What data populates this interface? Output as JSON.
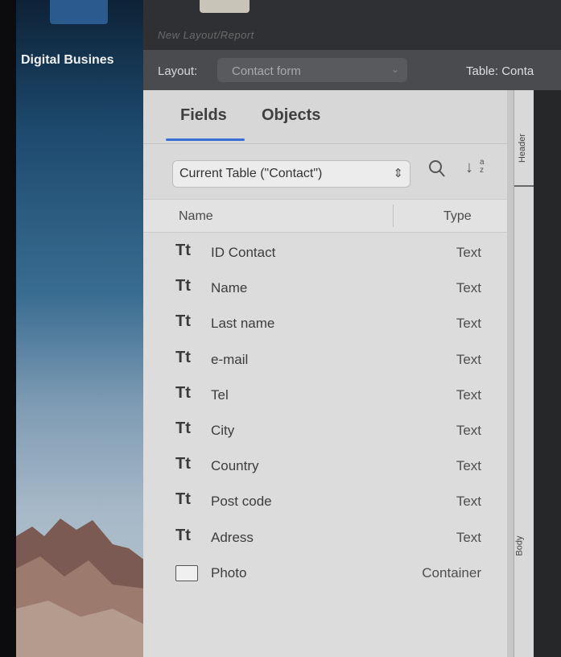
{
  "desktop": {
    "app_label": "Digital Busines"
  },
  "window": {
    "title": "New Layout/Report"
  },
  "layout_bar": {
    "layout_label": "Layout:",
    "layout_value": "Contact form",
    "table_label": "Table: Conta"
  },
  "tabs": [
    {
      "label": "Fields",
      "active": true
    },
    {
      "label": "Objects",
      "active": false
    }
  ],
  "toolbar": {
    "table_select_value": "Current Table (\"Contact\")",
    "sort_letters_top": "a",
    "sort_letters_bottom": "z"
  },
  "columns": {
    "name": "Name",
    "type": "Type"
  },
  "fields": [
    {
      "icon": "Tt",
      "name": "ID Contact",
      "type": "Text"
    },
    {
      "icon": "Tt",
      "name": "Name",
      "type": "Text"
    },
    {
      "icon": "Tt",
      "name": "Last name",
      "type": "Text"
    },
    {
      "icon": "Tt",
      "name": "e-mail",
      "type": "Text"
    },
    {
      "icon": "Tt",
      "name": "Tel",
      "type": "Text"
    },
    {
      "icon": "Tt",
      "name": "City",
      "type": "Text"
    },
    {
      "icon": "Tt",
      "name": "Country",
      "type": "Text"
    },
    {
      "icon": "Tt",
      "name": "Post code",
      "type": "Text"
    },
    {
      "icon": "Tt",
      "name": "Adress",
      "type": "Text"
    },
    {
      "icon": "photo-icon",
      "name": "Photo",
      "type": "Container"
    }
  ],
  "parts": {
    "header": "Header",
    "body": "Body"
  },
  "colors": {
    "accent": "#3b6fd8",
    "panel_bg": "#dcdcdc",
    "toolbar_bg": "#4a4b4e"
  }
}
